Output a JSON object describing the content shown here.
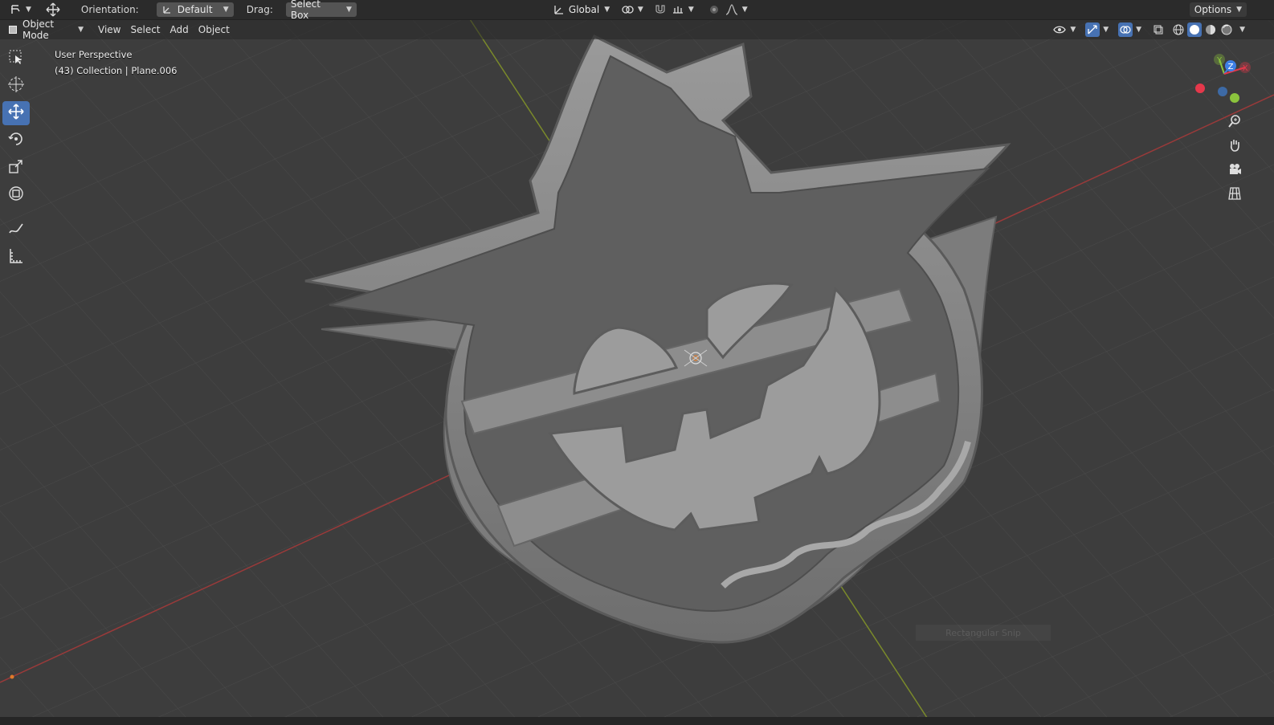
{
  "tool_header": {
    "orientation_label": "Orientation:",
    "orientation_value": "Default",
    "drag_label": "Drag:",
    "drag_value": "Select Box",
    "transform_space": "Global",
    "options_label": "Options"
  },
  "viewport_header": {
    "mode": "Object Mode",
    "menus": [
      "View",
      "Select",
      "Add",
      "Object"
    ]
  },
  "overlay": {
    "perspective": "User Perspective",
    "object_info": "(43) Collection | Plane.006"
  },
  "gizmo": {
    "axes": [
      "Y",
      "Z",
      "X"
    ],
    "colors": {
      "x": "#e5384b",
      "y": "#8bc43d",
      "z": "#3d7fe5"
    }
  },
  "watermark": "Rectangular Snip",
  "colors": {
    "background": "#3d3d3d",
    "accent": "#4772b3",
    "x_axis": "#9a3a3a",
    "y_axis": "#7a8a2a",
    "model": "#8a8a8a"
  },
  "icons": {
    "toolbar": [
      "select-box-icon",
      "cursor-icon",
      "move-icon",
      "rotate-icon",
      "scale-icon",
      "transform-icon",
      "annotate-icon",
      "measure-icon"
    ],
    "nav": [
      "zoom-icon",
      "hand-icon",
      "camera-icon",
      "grid-icon"
    ]
  }
}
